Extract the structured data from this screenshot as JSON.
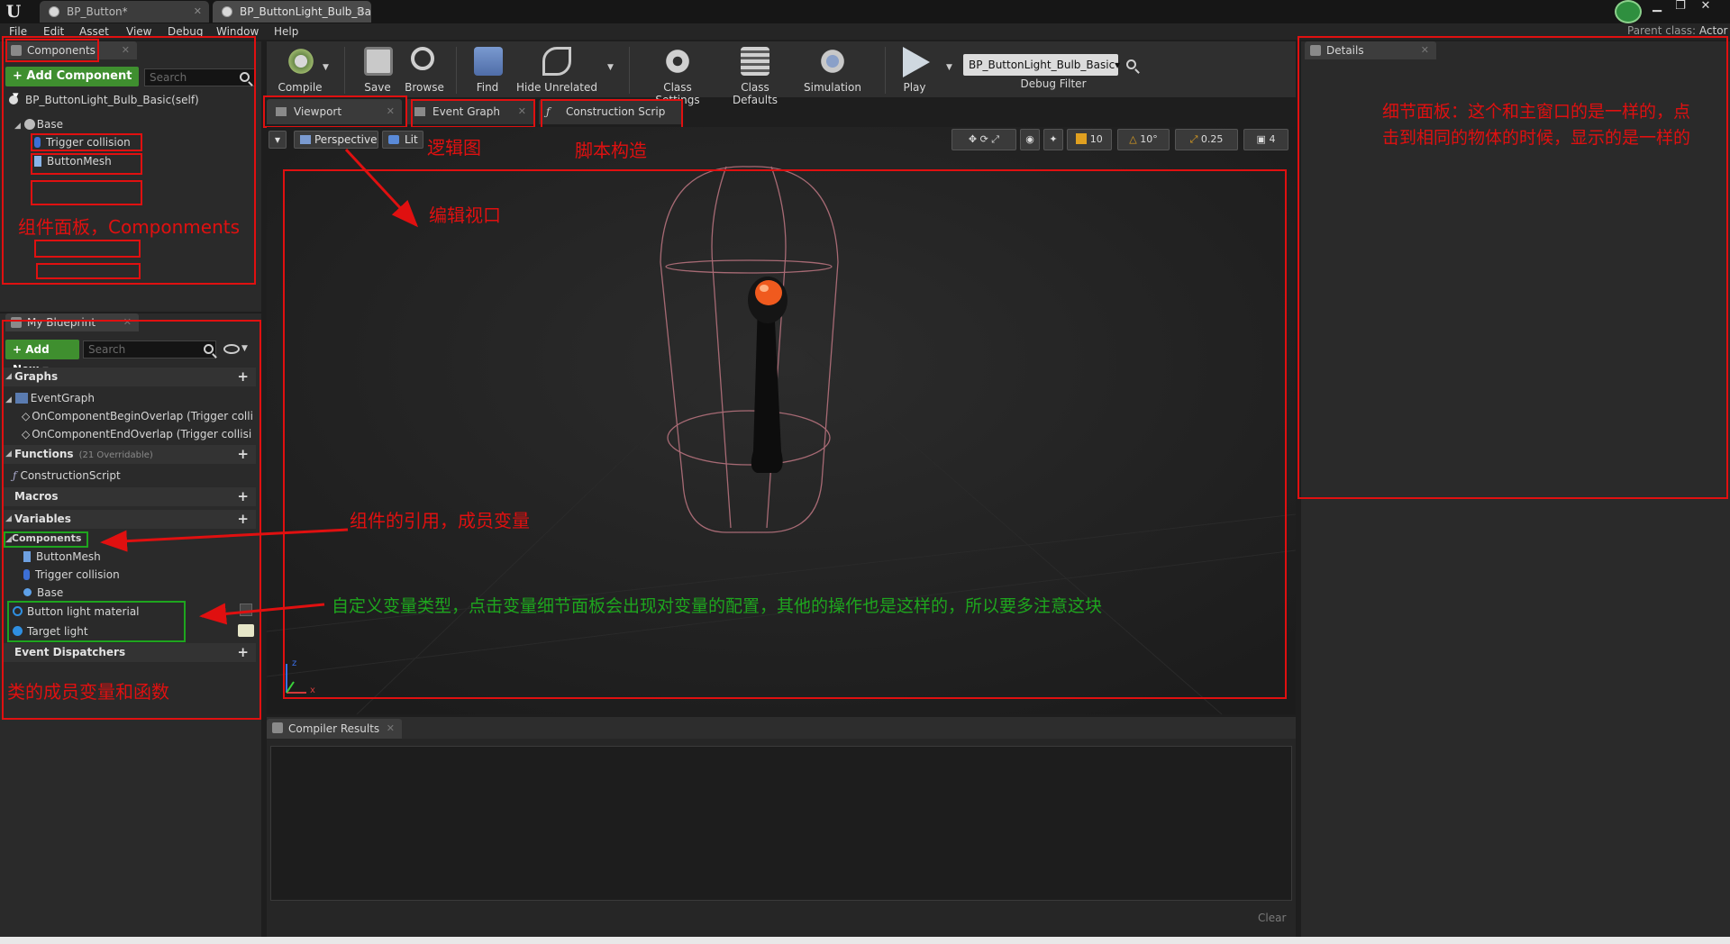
{
  "doc_tabs": [
    "BP_Button*",
    "BP_ButtonLight_Bulb_Ba"
  ],
  "menu": [
    "File",
    "Edit",
    "Asset",
    "View",
    "Debug",
    "Window",
    "Help"
  ],
  "parent_class": {
    "label": "Parent class:",
    "value": "Actor"
  },
  "components_panel": {
    "tab": "Components",
    "add_button": "+ Add Component ▾",
    "search_placeholder": "Search",
    "root": "BP_ButtonLight_Bulb_Basic(self)",
    "base": "Base",
    "children": [
      "Trigger collision",
      "ButtonMesh"
    ]
  },
  "my_blueprint": {
    "tab": "My Blueprint",
    "add_new": "+ Add New ▾",
    "search_placeholder": "Search",
    "graphs_header": "Graphs",
    "event_graph": "EventGraph",
    "events": [
      "OnComponentBeginOverlap (Trigger colli",
      "OnComponentEndOverlap (Trigger collisi"
    ],
    "functions_header": "Functions",
    "functions_count": "(21 Overridable)",
    "construction_script": "ConstructionScript",
    "macros_header": "Macros",
    "variables_header": "Variables",
    "components_header": "Components",
    "component_vars": [
      "ButtonMesh",
      "Trigger collision",
      "Base"
    ],
    "custom_vars": [
      "Button light material",
      "Target light"
    ],
    "dispatchers_header": "Event Dispatchers"
  },
  "toolbar": {
    "items": [
      "Compile",
      "Save",
      "Browse",
      "Find",
      "Hide Unrelated",
      "Class Settings",
      "Class Defaults",
      "Simulation",
      "Play"
    ],
    "debug_select": "BP_ButtonLight_Bulb_Basic▾",
    "debug_label": "Debug Filter"
  },
  "editor_tabs": [
    "Viewport",
    "Event Graph",
    "Construction Scrip"
  ],
  "viewport": {
    "perspective": "Perspective",
    "lit": "Lit",
    "grid_snap": "10",
    "rot_snap": "10°",
    "scale_snap": "0.25",
    "cam_speed": "4",
    "axis_x": "x",
    "axis_z": "z"
  },
  "details": {
    "tab": "Details"
  },
  "compiler": {
    "tab": "Compiler Results",
    "clear": "Clear"
  },
  "annotations": {
    "logic_graph": "逻辑图",
    "construction": "脚本构造",
    "viewport_edit": "编辑视口",
    "components_panel": "组件面板，Componments",
    "component_refs": "组件的引用，成员变量",
    "custom_vars": "自定义变量类型，点击变量细节面板会出现对变量的配置，其他的操作也是这样的，所以要多注意这块",
    "class_members": "类的成员变量和函数",
    "details_line1": "细节面板：这个和主窗口的是一样的，点",
    "details_line2": "击到相同的物体的时候，显示的是一样的"
  },
  "colors": {
    "annotation_red": "#e01010",
    "annotation_green": "#1ea51e",
    "add_green": "#3f8f2f"
  }
}
